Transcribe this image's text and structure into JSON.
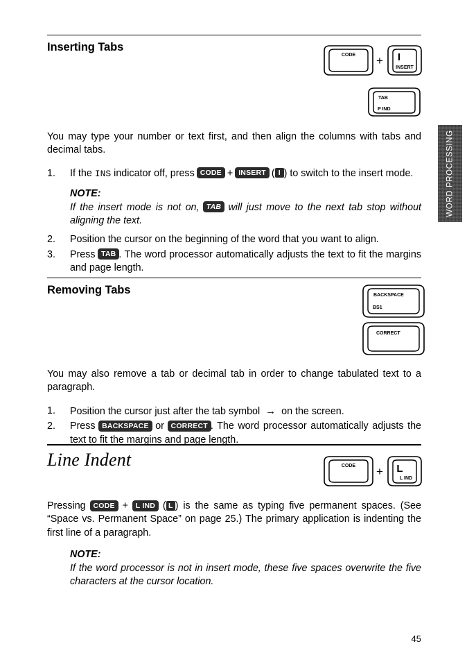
{
  "page": {
    "number": "45",
    "side_tab_label": "WORD PROCESSING"
  },
  "sections": [
    {
      "id": "inserting-tabs",
      "heading": "Inserting Tabs",
      "intro": "You may type your number or text first, and then align the columns with tabs and decimal tabs.",
      "steps": [
        {
          "num": "1.",
          "parts": {
            "a": "If the",
            "ins": "INS",
            "b": "indicator off, press",
            "key1": "CODE",
            "plus": "+",
            "key2": "INSERT",
            "paren_open": "(",
            "key3": "I",
            "paren_close": ")",
            "c": "to switch to the insert mode."
          }
        },
        {
          "num": "2.",
          "text": "Position the cursor on the beginning of the word that you want to align."
        },
        {
          "num": "3.",
          "parts": {
            "a": "Press",
            "key1": "TAB",
            "b": ". The word processor automatically adjusts the text to fit the margins and page length."
          }
        }
      ],
      "note": {
        "label": "NOTE:",
        "parts": {
          "a": "If the insert mode is not on,",
          "key1": "TAB",
          "b": "will just move to the next tab stop without aligning the text."
        }
      },
      "keys": [
        {
          "type": "combo",
          "left": {
            "shape": "wide",
            "top": "CODE",
            "bottom": ""
          },
          "operator": "+",
          "right": {
            "shape": "square",
            "top": "I",
            "bottom": "INSERT"
          }
        },
        {
          "type": "single",
          "key": {
            "shape": "wide",
            "top": "TAB",
            "bottom": "P IND"
          }
        }
      ]
    },
    {
      "id": "removing-tabs",
      "heading": "Removing Tabs",
      "intro": "You may also remove a tab or decimal tab in order to change tabulated text to a paragraph.",
      "steps": [
        {
          "num": "1.",
          "parts": {
            "a": "Position the cursor just after the tab symbol",
            "arrow": "→",
            "b": "on the screen."
          }
        },
        {
          "num": "2.",
          "parts": {
            "a": "Press",
            "key1": "BACKSPACE",
            "b": "or",
            "key2": "CORRECT",
            "c": ". The word processor automatically adjusts the text to fit the margins and page length."
          }
        }
      ],
      "keys": [
        {
          "type": "single",
          "key": {
            "shape": "wide",
            "top": "BACKSPACE",
            "bottom": "BS1"
          }
        },
        {
          "type": "single",
          "key": {
            "shape": "wide",
            "top": "CORRECT",
            "bottom": ""
          }
        }
      ]
    },
    {
      "id": "line-indent",
      "heading": "Line Indent",
      "body": {
        "a": "Pressing",
        "key1": "CODE",
        "plus": "+",
        "key2": "L IND",
        "paren_open": "(",
        "key3": "L",
        "paren_close": ")",
        "b": "is the same as typing five permanent spaces. (See “Space vs. Permanent Space” on page 25.) The primary application is indenting the first line of a paragraph."
      },
      "note": {
        "label": "NOTE:",
        "text": "If the word processor is not in insert mode, these five spaces overwrite the five characters at the cursor location."
      },
      "keys": [
        {
          "type": "combo",
          "left": {
            "shape": "wide",
            "top": "CODE",
            "bottom": ""
          },
          "operator": "+",
          "right": {
            "shape": "square",
            "top": "L",
            "bottom": "L IND"
          }
        }
      ]
    }
  ]
}
